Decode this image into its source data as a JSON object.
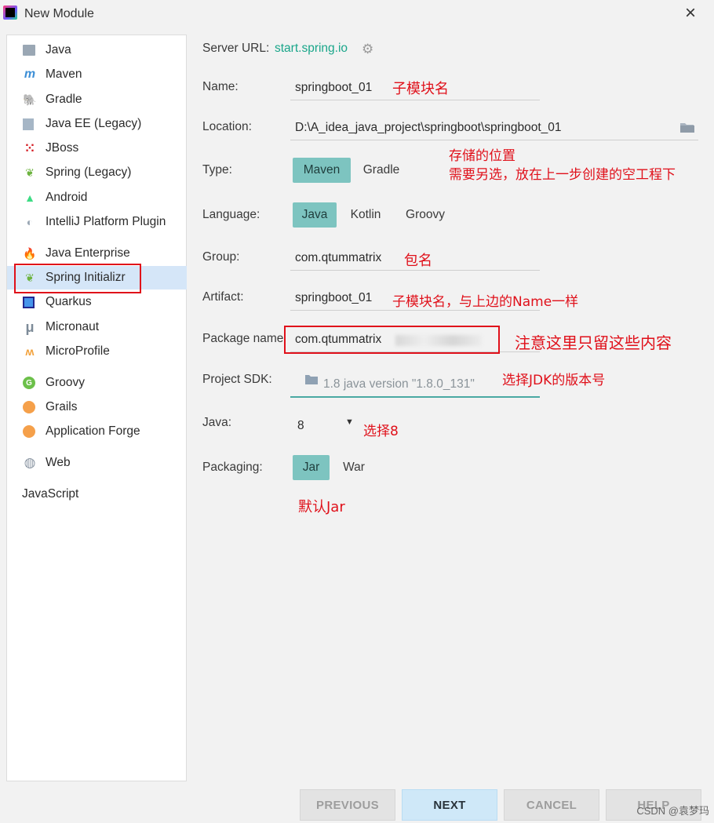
{
  "window": {
    "title": "New Module"
  },
  "sidebar": {
    "items": [
      {
        "label": "Java",
        "icon": "java-module-icon",
        "glyph": ""
      },
      {
        "label": "Maven",
        "icon": "maven-icon",
        "glyph": "m"
      },
      {
        "label": "Gradle",
        "icon": "gradle-icon",
        "glyph": "🐘"
      },
      {
        "label": "Java EE (Legacy)",
        "icon": "java-ee-icon",
        "glyph": ""
      },
      {
        "label": "JBoss",
        "icon": "jboss-icon",
        "glyph": "⁙"
      },
      {
        "label": "Spring (Legacy)",
        "icon": "spring-leaf-icon",
        "glyph": "❦"
      },
      {
        "label": "Android",
        "icon": "android-icon",
        "glyph": "▲"
      },
      {
        "label": "IntelliJ Platform Plugin",
        "icon": "plugin-icon",
        "glyph": "◐"
      },
      {
        "label": "Java Enterprise",
        "icon": "java-enterprise-icon",
        "glyph": "🔥"
      },
      {
        "label": "Spring Initializr",
        "icon": "spring-initializr-icon",
        "glyph": "❦"
      },
      {
        "label": "Quarkus",
        "icon": "quarkus-icon",
        "glyph": ""
      },
      {
        "label": "Micronaut",
        "icon": "micronaut-icon",
        "glyph": "μ"
      },
      {
        "label": "MicroProfile",
        "icon": "microprofile-icon",
        "glyph": "ʍ"
      },
      {
        "label": "Groovy",
        "icon": "groovy-icon",
        "glyph": "G"
      },
      {
        "label": "Grails",
        "icon": "grails-icon",
        "glyph": "◓"
      },
      {
        "label": "Application Forge",
        "icon": "application-forge-icon",
        "glyph": "◓"
      },
      {
        "label": "Web",
        "icon": "globe-icon",
        "glyph": "🌐"
      },
      {
        "label": "JavaScript",
        "icon": "",
        "glyph": ""
      }
    ]
  },
  "form": {
    "server_url_label": "Server URL:",
    "server_url_value": "start.spring.io",
    "name_label": "Name:",
    "name_value": "springboot_01",
    "location_label": "Location:",
    "location_value": "D:\\A_idea_java_project\\springboot\\springboot_01",
    "type_label": "Type:",
    "type_options": [
      "Maven",
      "Gradle"
    ],
    "language_label": "Language:",
    "language_options": [
      "Java",
      "Kotlin",
      "Groovy"
    ],
    "group_label": "Group:",
    "group_value": "com.qtummatrix",
    "artifact_label": "Artifact:",
    "artifact_value": "springboot_01",
    "package_label": "Package name",
    "package_value": "com.qtummatrix",
    "sdk_label": "Project SDK:",
    "sdk_value": "1.8 java version \"1.8.0_131\"",
    "java_label": "Java:",
    "java_value": "8",
    "packaging_label": "Packaging:",
    "packaging_options": [
      "Jar",
      "War"
    ]
  },
  "annotations": {
    "name_note": "子模块名",
    "location_note_1": "存储的位置",
    "location_note_2": "需要另选，放在上一步创建的空工程下",
    "group_note": "包名",
    "artifact_note": "子模块名，与上边的Name一样",
    "package_note": "注意这里只留这些内容",
    "sdk_note": "选择JDK的版本号",
    "java_note": "选择8",
    "packaging_note": "默认Jar"
  },
  "buttons": {
    "previous": "PREVIOUS",
    "next": "NEXT",
    "cancel": "CANCEL",
    "help": "HELP"
  },
  "watermark": "CSDN @袁梦玛",
  "colors": {
    "accent_selected": "#7dc4c0",
    "link": "#1aa68a",
    "annotation_red": "#e0101a",
    "sidebar_selected": "#d5e6f8"
  }
}
